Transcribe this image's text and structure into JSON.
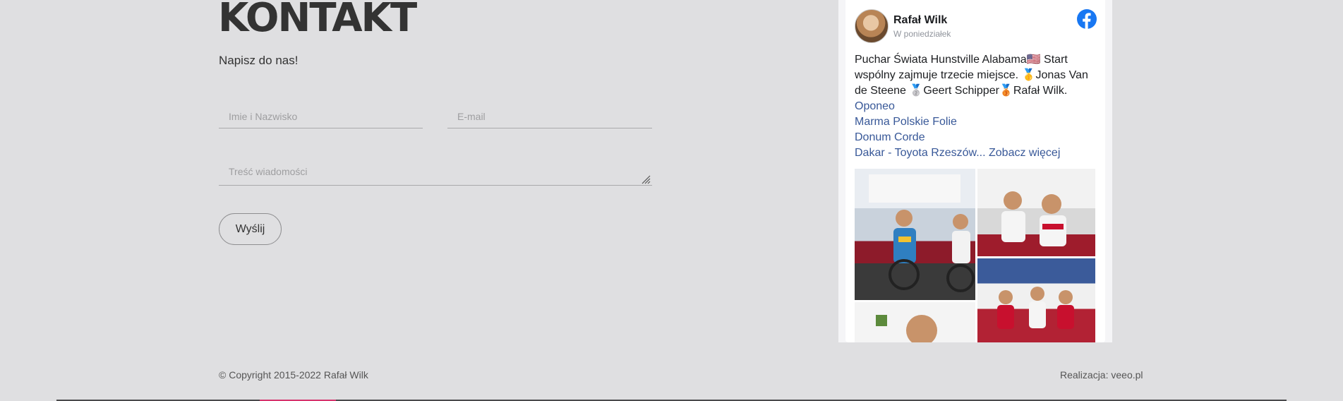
{
  "contact": {
    "title": "KONTAKT",
    "subtitle": "Napisz do nas!",
    "name_placeholder": "Imie i Nazwisko",
    "email_placeholder": "E-mail",
    "message_placeholder": "Treść wiadomości",
    "send_label": "Wyślij"
  },
  "facebook_post": {
    "author": "Rafał Wilk",
    "date": "W poniedziałek",
    "text": "Puchar Świata Hunstville Alabama🇺🇸 Start wspólny zajmuje trzecie miejsce. 🥇Jonas Van de Steene 🥈Geert Schipper🥉Rafał Wilk.",
    "links": [
      "Oponeo",
      "Marma Polskie Folie",
      "Donum Corde",
      "Dakar - Toyota Rzeszów... Zobacz więcej"
    ],
    "icons": {
      "avatar": "profile-photo",
      "logo": "facebook-icon"
    },
    "colors": {
      "link": "#385898",
      "brand": "#1877f2"
    }
  },
  "footer": {
    "copyright": "© Copyright 2015-2022 Rafał Wilk",
    "credit": "Realizacja: veeo.pl"
  }
}
